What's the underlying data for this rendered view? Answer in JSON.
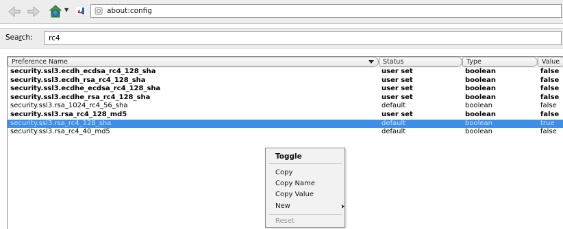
{
  "toolbar": {
    "back_icon": "back-arrow-icon",
    "forward_icon": "forward-arrow-icon",
    "home_icon": "globe-home-icon",
    "url": "about:config"
  },
  "search": {
    "label": "Search:",
    "value": "rc4"
  },
  "table": {
    "headers": {
      "name": "Preference Name",
      "status": "Status",
      "type": "Type",
      "value": "Value"
    },
    "rows": [
      {
        "name": "security.ssl3.ecdh_ecdsa_rc4_128_sha",
        "status": "user set",
        "type": "boolean",
        "value": "false",
        "user_set": true
      },
      {
        "name": "security.ssl3.ecdh_rsa_rc4_128_sha",
        "status": "user set",
        "type": "boolean",
        "value": "false",
        "user_set": true
      },
      {
        "name": "security.ssl3.ecdhe_ecdsa_rc4_128_sha",
        "status": "user set",
        "type": "boolean",
        "value": "false",
        "user_set": true
      },
      {
        "name": "security.ssl3.ecdhe_rsa_rc4_128_sha",
        "status": "user set",
        "type": "boolean",
        "value": "false",
        "user_set": true
      },
      {
        "name": "security.ssl3.rsa_1024_rc4_56_sha",
        "status": "default",
        "type": "boolean",
        "value": "false",
        "user_set": false
      },
      {
        "name": "security.ssl3.rsa_rc4_128_md5",
        "status": "user set",
        "type": "boolean",
        "value": "false",
        "user_set": true
      },
      {
        "name": "security.ssl3.rsa_rc4_128_sha",
        "status": "default",
        "type": "boolean",
        "value": "true",
        "user_set": false,
        "selected": true
      },
      {
        "name": "security.ssl3.rsa_rc4_40_md5",
        "status": "default",
        "type": "boolean",
        "value": "false",
        "user_set": false
      }
    ]
  },
  "context_menu": {
    "toggle": "Toggle",
    "copy": "Copy",
    "copy_name": "Copy Name",
    "copy_value": "Copy Value",
    "new": "New",
    "reset": "Reset"
  },
  "colors": {
    "selection": "#3d8ee8",
    "toolbar_bg": "#ededed"
  }
}
